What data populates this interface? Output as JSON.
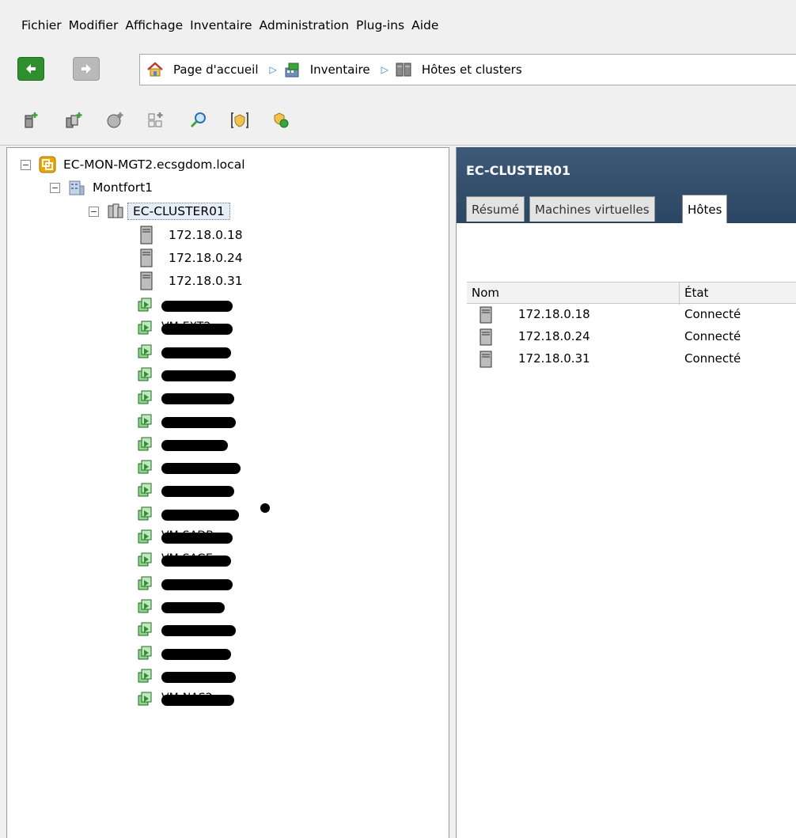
{
  "menu": [
    "Fichier",
    "Modifier",
    "Affichage",
    "Inventaire",
    "Administration",
    "Plug-ins",
    "Aide"
  ],
  "breadcrumb": {
    "items": [
      "Page d'accueil",
      "Inventaire",
      "Hôtes et clusters"
    ]
  },
  "toolbar": {
    "icons": [
      "add-host-icon",
      "add-cluster-icon",
      "new-datacenter-icon",
      "add-folder-icon",
      "search-icon",
      "permissions-icon",
      "migrate-icon"
    ]
  },
  "tree": {
    "vcenter": "EC-MON-MGT2.ecsgdom.local",
    "datacenter": "Montfort1",
    "cluster": "EC-CLUSTER01",
    "hosts": [
      "172.18.0.18",
      "172.18.0.24",
      "172.18.0.31"
    ],
    "vms": [
      "",
      "VM-EXT2",
      "",
      "",
      "",
      "",
      "",
      "",
      "",
      "",
      "VM-SADB",
      "VM-SAGE",
      "",
      "",
      "",
      "",
      "",
      "VM-NAS2"
    ]
  },
  "detail": {
    "title": "EC-CLUSTER01",
    "tabs": [
      "Résumé",
      "Machines virtuelles",
      "Hôtes"
    ],
    "columns": [
      "Nom",
      "État"
    ],
    "rows": [
      {
        "name": "172.18.0.18",
        "state": "Connecté"
      },
      {
        "name": "172.18.0.24",
        "state": "Connecté"
      },
      {
        "name": "172.18.0.31",
        "state": "Connecté"
      }
    ]
  },
  "colors": {
    "header_bg": "#2b4663",
    "nav_back": "#2f8f2f",
    "vm_icon": "#3aa63a",
    "breadcrumb_arrow": "#2a7bd4"
  }
}
